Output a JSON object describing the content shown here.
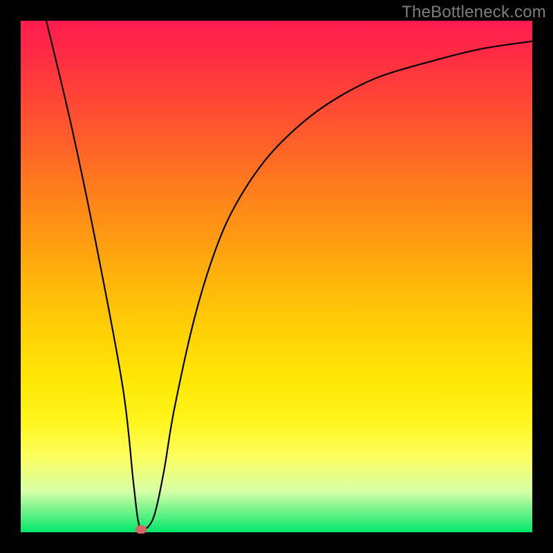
{
  "watermark": "TheBottleneck.com",
  "chart_data": {
    "type": "line",
    "title": "",
    "xlabel": "",
    "ylabel": "",
    "xlim": [
      0,
      100
    ],
    "ylim": [
      0,
      100
    ],
    "curve": {
      "x": [
        5,
        10,
        15,
        20,
        22,
        23,
        24,
        26,
        28,
        30,
        34,
        38,
        42,
        48,
        55,
        62,
        70,
        80,
        90,
        100
      ],
      "y": [
        100,
        79,
        55,
        28,
        10,
        2,
        0.5,
        3,
        12,
        24,
        42,
        55,
        64,
        73,
        80,
        85,
        89,
        92,
        94.5,
        96
      ]
    },
    "marker": {
      "x": 23.5,
      "y": 0.5
    },
    "background_gradient": {
      "top": "#ff1a4f",
      "bottom": "#00e76a"
    }
  }
}
